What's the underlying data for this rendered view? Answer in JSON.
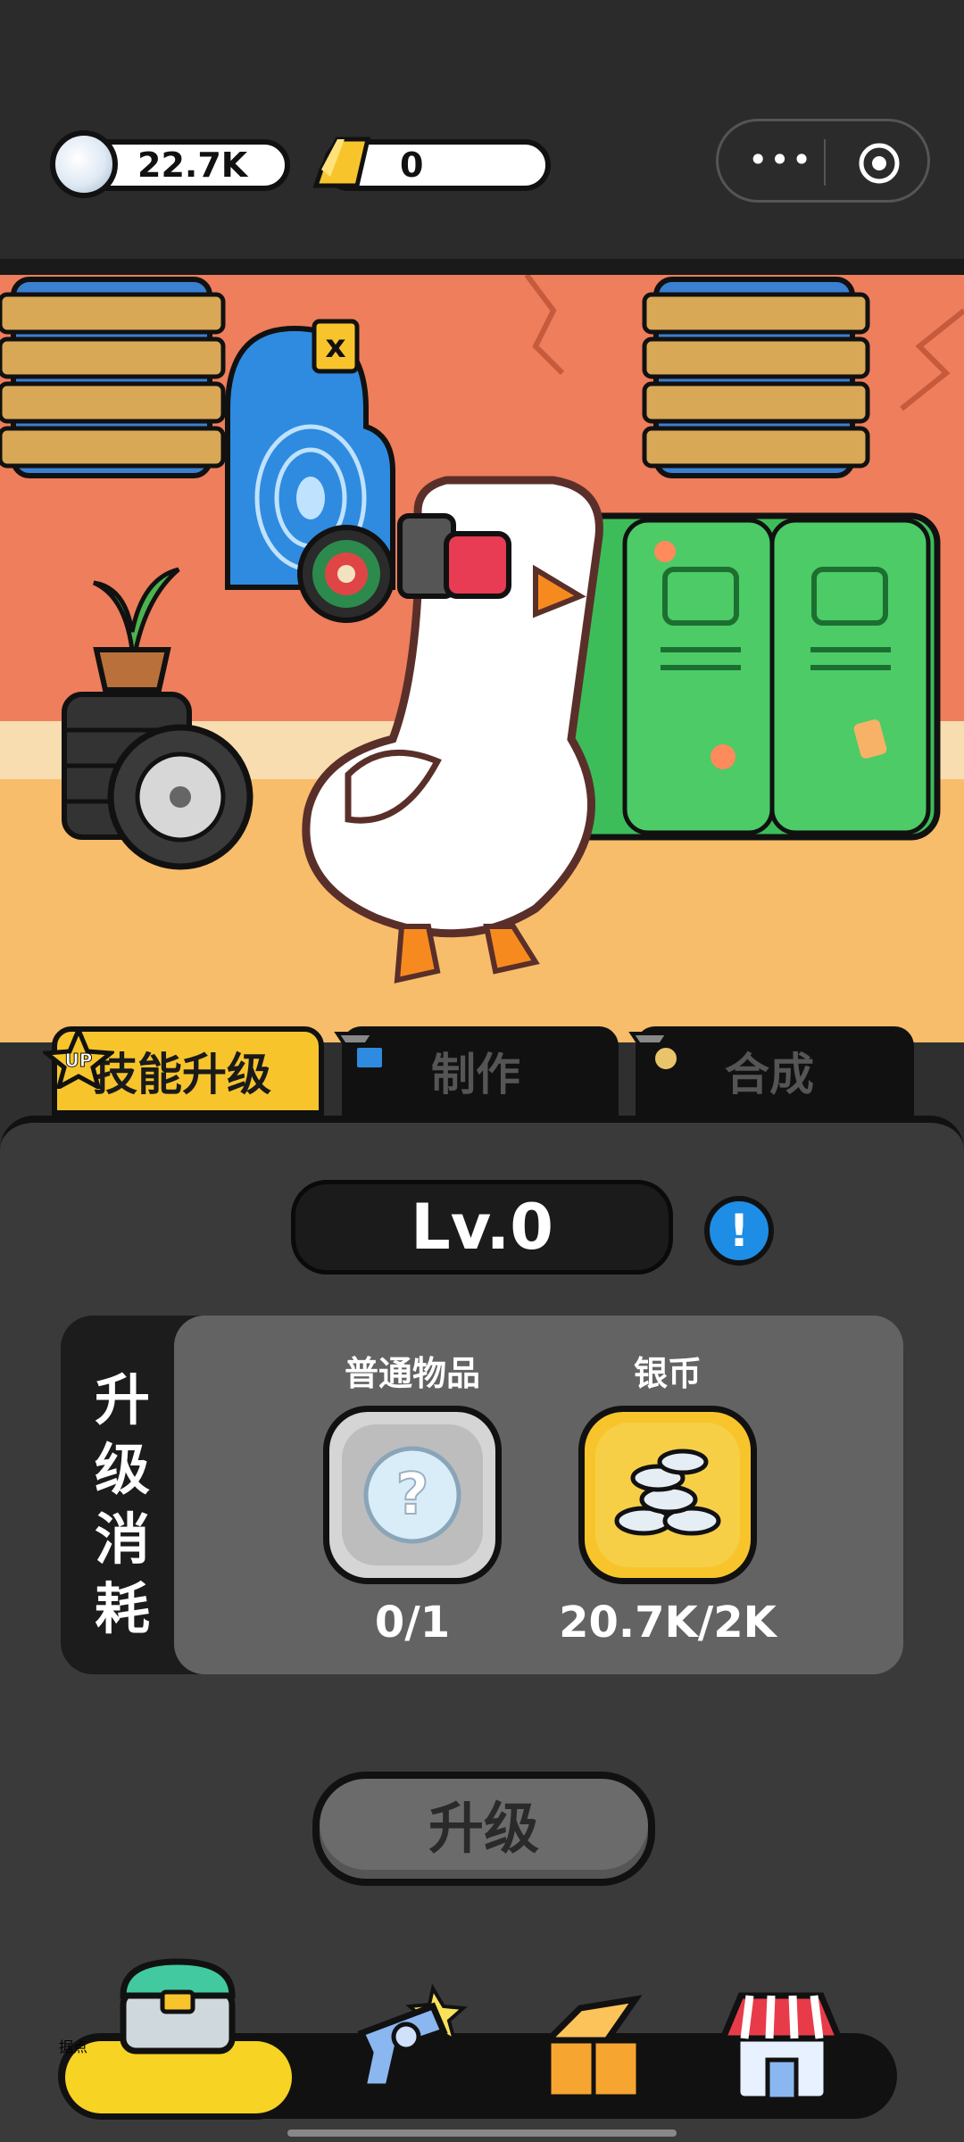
{
  "resources": {
    "silver_value": "22.7K",
    "gold_value": "0"
  },
  "capsule": {
    "more_icon": "more-dots-icon",
    "close_icon": "target-circle-icon"
  },
  "tabs": [
    {
      "label": "技能升级",
      "badge": "UP"
    },
    {
      "label": "制作"
    },
    {
      "label": "合成"
    }
  ],
  "panel": {
    "level": "Lv.0",
    "info_icon": "info-exclamation-icon",
    "cost_title": "升级消耗",
    "items": [
      {
        "label": "普通物品",
        "count": "0/1",
        "icon": "mystery-question-icon"
      },
      {
        "label": "银币",
        "count": "20.7K/2K",
        "icon": "silver-coin-stack-icon"
      }
    ],
    "upgrade_button": "升级"
  },
  "bottom_nav": {
    "home_label": "据点",
    "items": [
      "base-chest-icon",
      "revolver-icon",
      "open-box-icon",
      "shop-house-icon"
    ]
  },
  "colors": {
    "accent_yellow": "#f7c52b",
    "wall": "#ee7e5c",
    "floor": "#f8bd6a",
    "locker_green": "#3dbd5a",
    "info_blue": "#1e8de6"
  }
}
